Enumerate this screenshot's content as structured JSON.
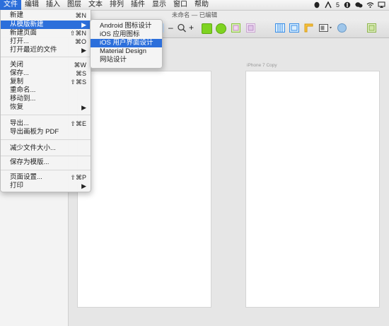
{
  "menubar": {
    "items": [
      "文件",
      "编辑",
      "插入",
      "图层",
      "文本",
      "排列",
      "插件",
      "显示",
      "窗口",
      "帮助"
    ],
    "badge_count": "5"
  },
  "window": {
    "title": "未命名",
    "status": "— 已编辑"
  },
  "file_menu": {
    "items": [
      {
        "label": "新建",
        "shortcut": "⌘N"
      },
      {
        "label": "从模版新建",
        "shortcut": "▶"
      },
      {
        "label": "新建页面",
        "shortcut": "⇧⌘N"
      },
      {
        "label": "打开...",
        "shortcut": "⌘O"
      },
      {
        "label": "打开最近的文件",
        "shortcut": "▶"
      },
      {
        "label": "关闭",
        "shortcut": "⌘W"
      },
      {
        "label": "保存...",
        "shortcut": "⌘S"
      },
      {
        "label": "复制",
        "shortcut": "⇧⌘S"
      },
      {
        "label": "重命名...",
        "shortcut": ""
      },
      {
        "label": "移动到...",
        "shortcut": ""
      },
      {
        "label": "恢复",
        "shortcut": "▶"
      },
      {
        "label": "导出...",
        "shortcut": "⇧⌘E"
      },
      {
        "label": "导出画板为 PDF",
        "shortcut": ""
      },
      {
        "label": "减少文件大小...",
        "shortcut": ""
      },
      {
        "label": "保存为模版...",
        "shortcut": ""
      },
      {
        "label": "页面设置...",
        "shortcut": "⇧⌘P"
      },
      {
        "label": "打印",
        "shortcut": "▶"
      }
    ]
  },
  "template_submenu": {
    "items": [
      "Android 图标设计",
      "iOS 应用图标",
      "iOS 用户界面设计",
      "Material Design",
      "网站设计"
    ]
  },
  "toolbar": {
    "zoom_out": "–",
    "zoom_in": "+"
  },
  "artboards": {
    "right_label": "iPhone 7 Copy"
  }
}
